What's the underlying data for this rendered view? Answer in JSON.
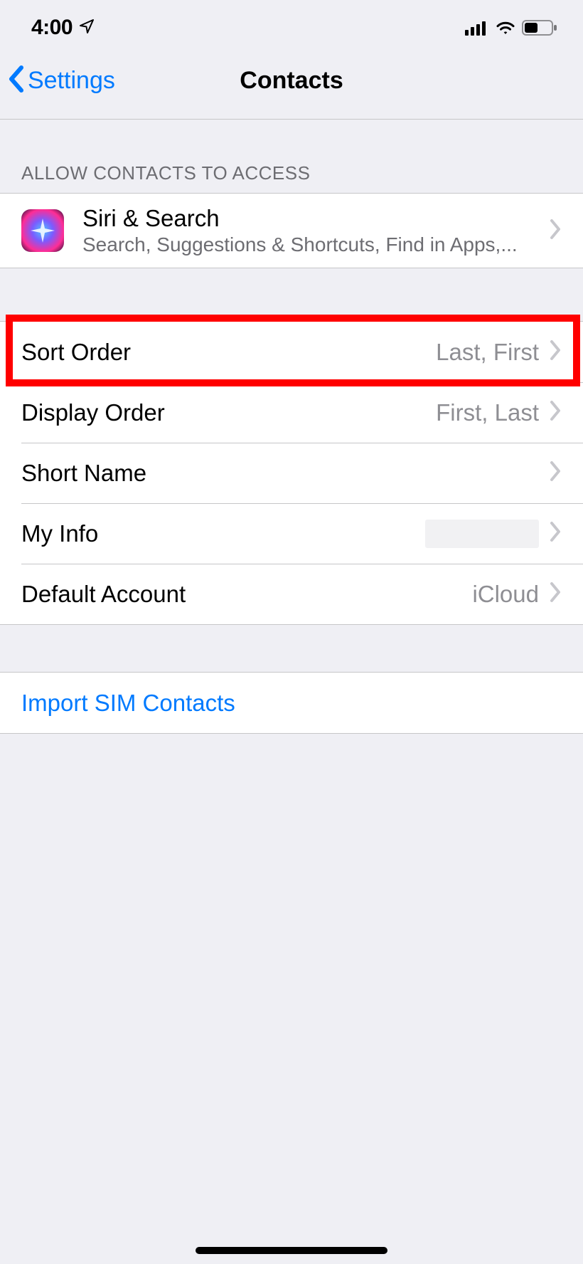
{
  "status": {
    "time": "4:00"
  },
  "nav": {
    "back_label": "Settings",
    "title": "Contacts"
  },
  "sections": {
    "access_header": "ALLOW CONTACTS TO ACCESS",
    "siri": {
      "title": "Siri & Search",
      "subtitle": "Search, Suggestions & Shortcuts, Find in Apps,..."
    },
    "rows": {
      "sort_order": {
        "label": "Sort Order",
        "value": "Last, First"
      },
      "display_order": {
        "label": "Display Order",
        "value": "First, Last"
      },
      "short_name": {
        "label": "Short Name",
        "value": ""
      },
      "my_info": {
        "label": "My Info",
        "value": ""
      },
      "default_account": {
        "label": "Default Account",
        "value": "iCloud"
      }
    },
    "import_sim": "Import SIM Contacts"
  }
}
